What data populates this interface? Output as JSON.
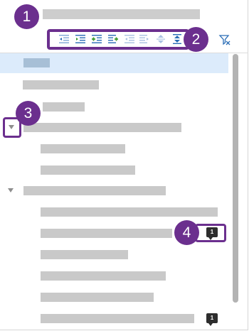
{
  "callouts": {
    "c1": "1",
    "c2": "2",
    "c3": "3",
    "c4": "4"
  },
  "badges": {
    "row_row10": "1",
    "row_row14": "1"
  },
  "toolbar": {
    "buttons": [
      "outdent-icon",
      "indent-icon",
      "indent-add-icon",
      "indent-list-icon",
      "outdent-disabled-icon",
      "indent-disabled-icon",
      "collapse-icon",
      "expand-collapse-icon"
    ],
    "filter_icon": "filter-icon"
  },
  "colors": {
    "accent": "#6b2f8e",
    "selected_row": "#dcebfb",
    "placeholder_bar": "#c9c9c9",
    "toolbar_blue": "#2a6db6",
    "toolbar_green": "#3a9a2c"
  },
  "tree": {
    "rows": [
      {
        "id": "row1",
        "selected": true
      },
      {
        "id": "row2"
      },
      {
        "id": "row3"
      },
      {
        "id": "row4",
        "expandable": true,
        "expanded": true
      },
      {
        "id": "row5"
      },
      {
        "id": "row6"
      },
      {
        "id": "row7",
        "expandable": true,
        "expanded": true
      },
      {
        "id": "row8"
      },
      {
        "id": "row9"
      },
      {
        "id": "row10",
        "comments": 1
      },
      {
        "id": "row11"
      },
      {
        "id": "row12"
      },
      {
        "id": "row13"
      },
      {
        "id": "row14",
        "comments": 1
      }
    ]
  }
}
